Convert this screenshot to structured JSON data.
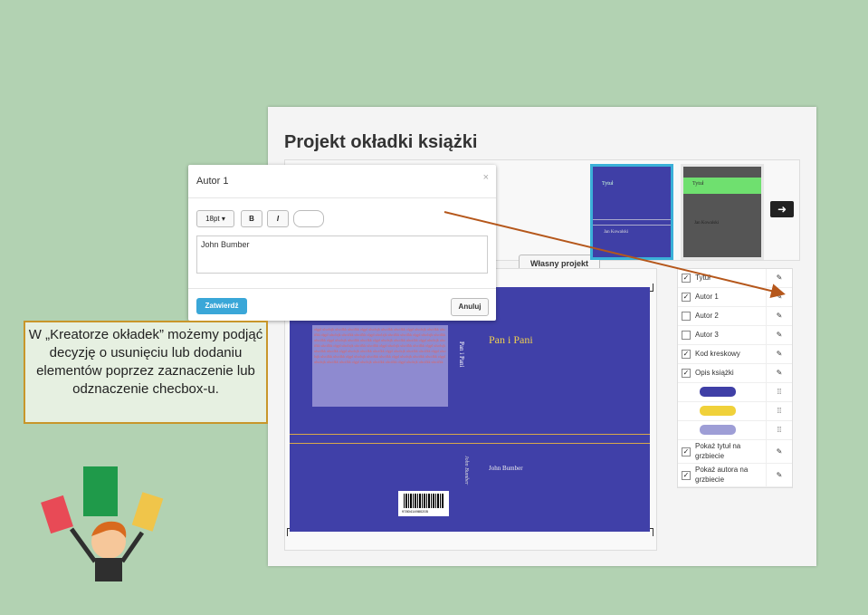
{
  "page": {
    "title": "Projekt okładki książki",
    "own_project_label": "Własny projekt",
    "next_label": "➜"
  },
  "templates": [
    {
      "title": "Tytuł",
      "author": "Jan Kowalski",
      "accent": "#3f3fa6"
    },
    {
      "title": "Tytuł",
      "author": "Jan Kowalski",
      "accent": "#6fe06f"
    }
  ],
  "cover": {
    "title": "Pan i Pani",
    "spine_title": "Pan i Pani",
    "author": "John Bumber",
    "spine_author": "John Bumber",
    "barcode_number": "9780414980205",
    "back_text": "olgpl ulsolxjk ulscifkk ulscifkk olgpl ulsolxjk ulscifkk ulscifkk olgpl ulsolxjk ulscifkk ulscifkk olgpl ulsolxjk ulscifkk ulscifkk olgpl ulsolxjk ulscifkk ulscifkk olgpl ulsolxjk ulscifkk ulscifkk olgpl ulsolxjk ulscifkk ulscifkk olgpl ulsolxjk ulscifkk ulscifkk olgpl ulsolxjk ulscifkk ulscifkk olgpl ulsolxjk ulscifkk ulscifkk olgpl ulsolxjk ulscifkk ulscifkk olgpl ulsolxjk ulscifkk ulscifkk olgpl ulsolxjk ulscifkk ulscifkk olgpl ulsolxjk ulscifkk ulscifkk olgpl ulsolxjk ulscifkk ulscifkk olgpl ulsolxjk ulscifkk ulscifkk olgpl ulsolxjk ulscifkk ulscifkk olgpl ulsolxjk ulscifkk ulscifkk olgpl ulsolxjk ulscifkk ulscifkk olgpl ulsolxjk ulscifkk ulscifkk",
    "background": "#4040a8"
  },
  "elements": [
    {
      "label": "Tytuł",
      "checked": true,
      "action": "edit-icon"
    },
    {
      "label": "Autor 1",
      "checked": true,
      "action": "edit-icon"
    },
    {
      "label": "Autor 2",
      "checked": false,
      "action": "edit-icon"
    },
    {
      "label": "Autor 3",
      "checked": false,
      "action": "edit-icon"
    },
    {
      "label": "Kod kreskowy",
      "checked": true,
      "action": "edit-icon"
    },
    {
      "label": "Opis książki",
      "checked": true,
      "action": "edit-icon"
    }
  ],
  "colors": [
    {
      "value": "#3f3fa6",
      "action": "grid-icon"
    },
    {
      "value": "#f0d13a",
      "action": "grid-icon"
    },
    {
      "value": "#9e9ed6",
      "action": "grid-icon"
    }
  ],
  "toggles": [
    {
      "label": "Pokaż tytuł na grzbiecie",
      "checked": true,
      "action": "edit-icon"
    },
    {
      "label": "Pokaż autora na grzbiecie",
      "checked": true,
      "action": "edit-icon"
    }
  ],
  "modal": {
    "title": "Autor 1",
    "close": "×",
    "font_size": "18pt",
    "bold": "B",
    "italic": "I",
    "text": "John Bumber",
    "confirm": "Zatwierdź",
    "cancel": "Anuluj"
  },
  "callout": {
    "text": "W „Kreatorze okładek” możemy podjąć decyzję o usunięciu lub dodaniu elementów poprzez zaznaczenie lub odznaczenie checbox-u."
  }
}
